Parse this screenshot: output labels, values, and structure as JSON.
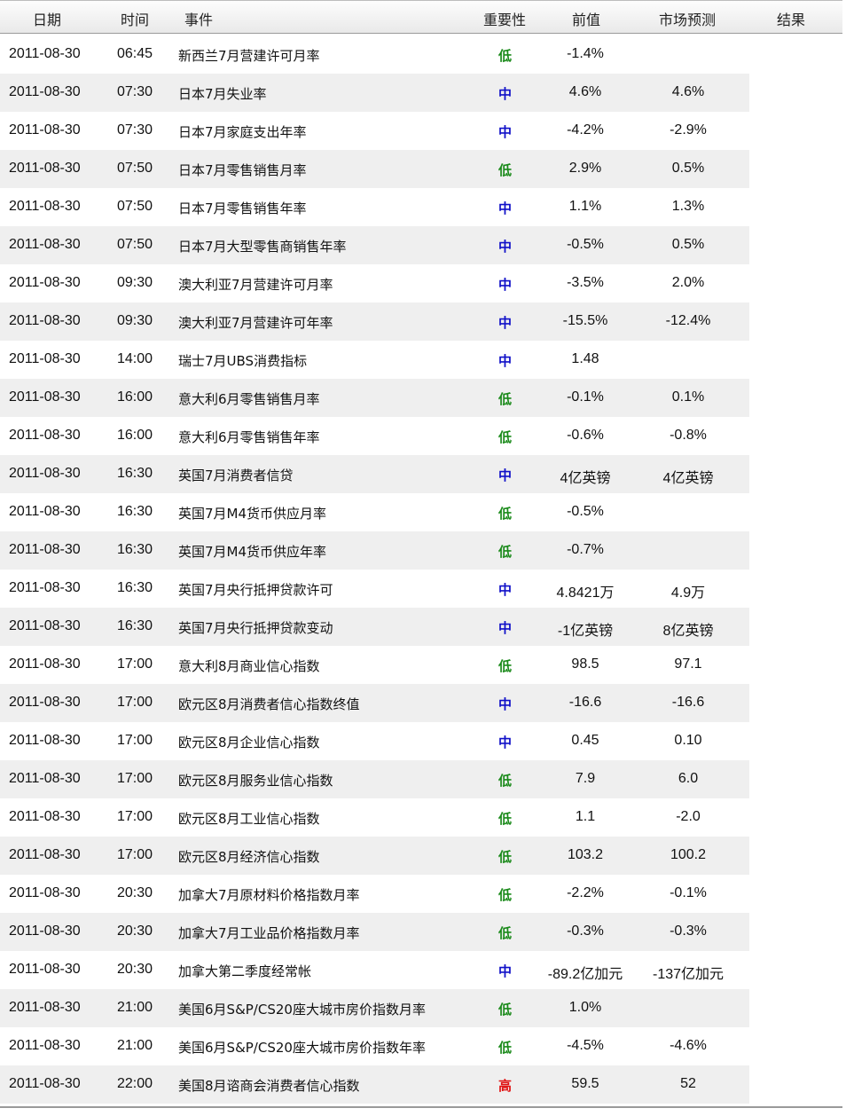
{
  "headers": {
    "date": "日期",
    "time": "时间",
    "event": "事件",
    "importance": "重要性",
    "previous": "前值",
    "forecast": "市场预测",
    "result": "结果"
  },
  "importance_colors": {
    "低": "#1a8a1a",
    "中": "#1010c8",
    "高": "#e01010"
  },
  "rows": [
    {
      "date": "2011-08-30",
      "time": "06:45",
      "event": "新西兰7月营建许可月率",
      "importance": "低",
      "previous": "-1.4%",
      "forecast": "",
      "result": ""
    },
    {
      "date": "2011-08-30",
      "time": "07:30",
      "event": "日本7月失业率",
      "importance": "中",
      "previous": "4.6%",
      "forecast": "4.6%",
      "result": ""
    },
    {
      "date": "2011-08-30",
      "time": "07:30",
      "event": "日本7月家庭支出年率",
      "importance": "中",
      "previous": "-4.2%",
      "forecast": "-2.9%",
      "result": ""
    },
    {
      "date": "2011-08-30",
      "time": "07:50",
      "event": "日本7月零售销售月率",
      "importance": "低",
      "previous": "2.9%",
      "forecast": "0.5%",
      "result": ""
    },
    {
      "date": "2011-08-30",
      "time": "07:50",
      "event": "日本7月零售销售年率",
      "importance": "中",
      "previous": "1.1%",
      "forecast": "1.3%",
      "result": ""
    },
    {
      "date": "2011-08-30",
      "time": "07:50",
      "event": "日本7月大型零售商销售年率",
      "importance": "中",
      "previous": "-0.5%",
      "forecast": "0.5%",
      "result": ""
    },
    {
      "date": "2011-08-30",
      "time": "09:30",
      "event": "澳大利亚7月营建许可月率",
      "importance": "中",
      "previous": "-3.5%",
      "forecast": "2.0%",
      "result": ""
    },
    {
      "date": "2011-08-30",
      "time": "09:30",
      "event": "澳大利亚7月营建许可年率",
      "importance": "中",
      "previous": "-15.5%",
      "forecast": "-12.4%",
      "result": ""
    },
    {
      "date": "2011-08-30",
      "time": "14:00",
      "event": "瑞士7月UBS消费指标",
      "importance": "中",
      "previous": "1.48",
      "forecast": "",
      "result": ""
    },
    {
      "date": "2011-08-30",
      "time": "16:00",
      "event": "意大利6月零售销售月率",
      "importance": "低",
      "previous": "-0.1%",
      "forecast": "0.1%",
      "result": ""
    },
    {
      "date": "2011-08-30",
      "time": "16:00",
      "event": "意大利6月零售销售年率",
      "importance": "低",
      "previous": "-0.6%",
      "forecast": "-0.8%",
      "result": ""
    },
    {
      "date": "2011-08-30",
      "time": "16:30",
      "event": "英国7月消费者信贷",
      "importance": "中",
      "previous": "4亿英镑",
      "forecast": "4亿英镑",
      "result": ""
    },
    {
      "date": "2011-08-30",
      "time": "16:30",
      "event": "英国7月M4货币供应月率",
      "importance": "低",
      "previous": "-0.5%",
      "forecast": "",
      "result": ""
    },
    {
      "date": "2011-08-30",
      "time": "16:30",
      "event": "英国7月M4货币供应年率",
      "importance": "低",
      "previous": "-0.7%",
      "forecast": "",
      "result": ""
    },
    {
      "date": "2011-08-30",
      "time": "16:30",
      "event": "英国7月央行抵押贷款许可",
      "importance": "中",
      "previous": "4.8421万",
      "forecast": "4.9万",
      "result": ""
    },
    {
      "date": "2011-08-30",
      "time": "16:30",
      "event": "英国7月央行抵押贷款变动",
      "importance": "中",
      "previous": "-1亿英镑",
      "forecast": "8亿英镑",
      "result": ""
    },
    {
      "date": "2011-08-30",
      "time": "17:00",
      "event": "意大利8月商业信心指数",
      "importance": "低",
      "previous": "98.5",
      "forecast": "97.1",
      "result": ""
    },
    {
      "date": "2011-08-30",
      "time": "17:00",
      "event": "欧元区8月消费者信心指数终值",
      "importance": "中",
      "previous": "-16.6",
      "forecast": "-16.6",
      "result": ""
    },
    {
      "date": "2011-08-30",
      "time": "17:00",
      "event": "欧元区8月企业信心指数",
      "importance": "中",
      "previous": "0.45",
      "forecast": "0.10",
      "result": ""
    },
    {
      "date": "2011-08-30",
      "time": "17:00",
      "event": "欧元区8月服务业信心指数",
      "importance": "低",
      "previous": "7.9",
      "forecast": "6.0",
      "result": ""
    },
    {
      "date": "2011-08-30",
      "time": "17:00",
      "event": "欧元区8月工业信心指数",
      "importance": "低",
      "previous": "1.1",
      "forecast": "-2.0",
      "result": ""
    },
    {
      "date": "2011-08-30",
      "time": "17:00",
      "event": "欧元区8月经济信心指数",
      "importance": "低",
      "previous": "103.2",
      "forecast": "100.2",
      "result": ""
    },
    {
      "date": "2011-08-30",
      "time": "20:30",
      "event": "加拿大7月原材料价格指数月率",
      "importance": "低",
      "previous": "-2.2%",
      "forecast": "-0.1%",
      "result": ""
    },
    {
      "date": "2011-08-30",
      "time": "20:30",
      "event": "加拿大7月工业品价格指数月率",
      "importance": "低",
      "previous": "-0.3%",
      "forecast": "-0.3%",
      "result": ""
    },
    {
      "date": "2011-08-30",
      "time": "20:30",
      "event": "加拿大第二季度经常帐",
      "importance": "中",
      "previous": "-89.2亿加元",
      "forecast": "-137亿加元",
      "result": ""
    },
    {
      "date": "2011-08-30",
      "time": "21:00",
      "event": "美国6月S&P/CS20座大城市房价指数月率",
      "importance": "低",
      "previous": "1.0%",
      "forecast": "",
      "result": ""
    },
    {
      "date": "2011-08-30",
      "time": "21:00",
      "event": "美国6月S&P/CS20座大城市房价指数年率",
      "importance": "低",
      "previous": "-4.5%",
      "forecast": "-4.6%",
      "result": ""
    },
    {
      "date": "2011-08-30",
      "time": "22:00",
      "event": "美国8月谘商会消费者信心指数",
      "importance": "高",
      "previous": "59.5",
      "forecast": "52",
      "result": ""
    }
  ]
}
